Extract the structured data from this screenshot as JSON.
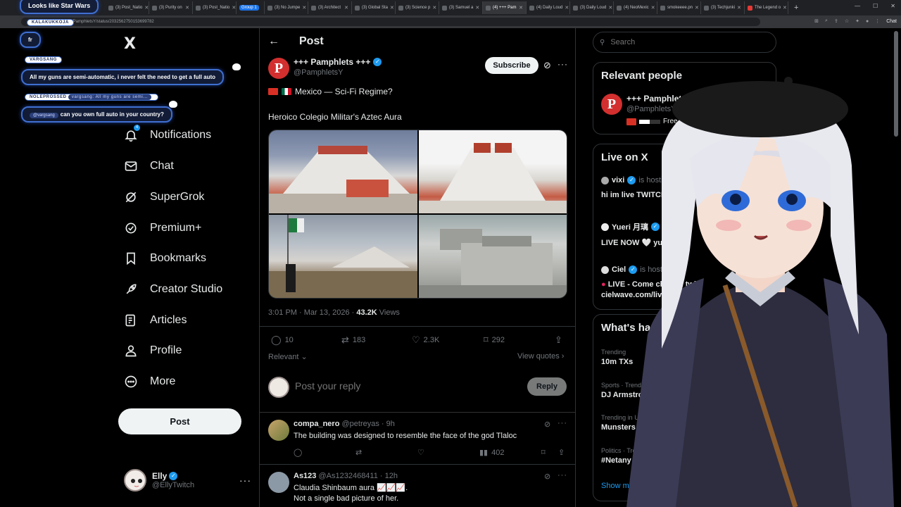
{
  "browser": {
    "tabs": [
      {
        "label": "(3) Post_Natio"
      },
      {
        "label": "(3) Purity on"
      },
      {
        "label": "(3) Post_Natio"
      },
      {
        "label": "Group 1",
        "group": true
      },
      {
        "label": "(3) No Jumpe"
      },
      {
        "label": "(3) Architect"
      },
      {
        "label": "(3) Global Sta"
      },
      {
        "label": "(3) Science p"
      },
      {
        "label": "(3) Samuel a"
      },
      {
        "label": "(4) +++ Pam",
        "active": true
      },
      {
        "label": "(4) Daily Loud"
      },
      {
        "label": "(3) Daily Loud"
      },
      {
        "label": "(4) NeoMexic"
      },
      {
        "label": "smokeeee.pn"
      },
      {
        "label": "(3) Techjunki"
      },
      {
        "label": "The Legend o"
      }
    ],
    "url": "x.com/PamphletsY/status/2032562750153699782",
    "chat_button": "Chat"
  },
  "nav": {
    "logo": "X",
    "items": [
      {
        "label": "Notifications",
        "icon": "bell-icon",
        "badge": "4"
      },
      {
        "label": "Chat",
        "icon": "mail-icon"
      },
      {
        "label": "SuperGrok",
        "icon": "grok-icon"
      },
      {
        "label": "Premium+",
        "icon": "premium-icon"
      },
      {
        "label": "Bookmarks",
        "icon": "bookmark-icon"
      },
      {
        "label": "Creator Studio",
        "icon": "rocket-icon"
      },
      {
        "label": "Articles",
        "icon": "articles-icon"
      },
      {
        "label": "Profile",
        "icon": "profile-icon"
      },
      {
        "label": "More",
        "icon": "more-icon"
      }
    ],
    "post_button": "Post",
    "account": {
      "name": "Elly",
      "handle": "@EllyTwitch"
    }
  },
  "post": {
    "header_title": "Post",
    "author_name": "+++ Pamphlets +++",
    "author_handle": "@PamphletsY",
    "author_initial": "P",
    "subscribe_label": "Subscribe",
    "line1": "Mexico — Sci-Fi Regime?",
    "line2": "Heroico Colegio Militar's Aztec Aura",
    "timestamp": "3:01 PM · Mar 13, 2026 · ",
    "views_count": "43.2K",
    "views_label": " Views",
    "replies": "10",
    "reposts": "183",
    "likes": "2.3K",
    "bookmarks": "292",
    "sort_label": "Relevant",
    "view_quotes": "View quotes",
    "reply_placeholder": "Post your reply",
    "reply_button": "Reply"
  },
  "comments": [
    {
      "name": "compa_nero",
      "handle": "@petreyas · 9h",
      "text": "The building was designed to resemble the face of the god Tlaloc",
      "views": "402"
    },
    {
      "name": "As123",
      "handle": "@As1232468411 · 12h",
      "text": "Claudia Shinbaum aura 📈📈📈.",
      "text2": "Not a single bad picture of her."
    }
  ],
  "sidebar": {
    "search_placeholder": "Search",
    "relevant_title": "Relevant people",
    "relevant_person": {
      "name": "+++ Pamphlet",
      "handle": "@PamphletsY",
      "bio": "Free H"
    },
    "live_title": "Live on X",
    "live": [
      {
        "host": "vixi",
        "hosting": "is hosting",
        "text": "hi im live TWITCH.TV/"
      },
      {
        "host": "Yueri 月璃",
        "hosting": "is",
        "text": "LIVE NOW 🤍 yueri on"
      },
      {
        "host": "Ciel",
        "hosting": "is hosting",
        "text": "LIVE - Come chat on twit",
        "text2": "cielwave.com/live"
      }
    ],
    "happening_title": "What's hap",
    "trends": [
      {
        "meta": "Trending",
        "name": "10m TXs"
      },
      {
        "meta": "Sports · Trendin",
        "name": "DJ Armstron"
      },
      {
        "meta": "Trending in U",
        "name": "Munsters"
      },
      {
        "meta": "Politics · Tre",
        "name": "#Netany"
      }
    ],
    "show_more": "Show m"
  },
  "chat_overlay": [
    {
      "user": "",
      "text": "Looks like Star Wars"
    },
    {
      "user": "KALAKUKKOJA",
      "text": "fr"
    },
    {
      "user": "VARGSANG",
      "text": "All my guns are semi-automatic, i never felt the need to get a full auto"
    },
    {
      "user": "NOLEPROSSED",
      "reply_ref": "vargsang: All my guns are semi...",
      "mention": "@vargsang",
      "text": "can you own full auto in your country?"
    }
  ],
  "colors": {
    "accent": "#1d9bf0",
    "background": "#000000",
    "chat_border": "#3f6fd0",
    "brand_red": "#d32f2f"
  }
}
